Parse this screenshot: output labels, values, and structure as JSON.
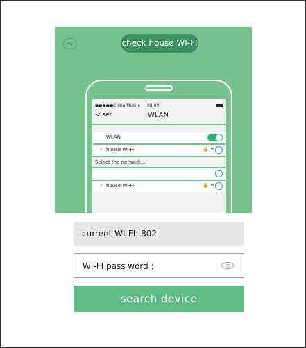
{
  "guide": {
    "back_icon": "chevron-left-icon",
    "title": "check house WI-FI"
  },
  "phone": {
    "status": {
      "carrier": "●●●●●China Mobile",
      "time": "08:49"
    },
    "nav": {
      "back": "< set",
      "title": "WLAN"
    },
    "wlan_label": "WLAN",
    "wlan_toggle_on": true,
    "connected_network": "house Wi-Fi",
    "select_prompt": "Select the network...",
    "network_option": "house Wi-Fi"
  },
  "form": {
    "current_wifi": "current WI-FI: 802",
    "password_placeholder": "WI-FI pass word :",
    "search_button": "search device"
  },
  "colors": {
    "accent": "#5fbe86",
    "panel": "#77c18f",
    "pill": "#3b8f60"
  }
}
